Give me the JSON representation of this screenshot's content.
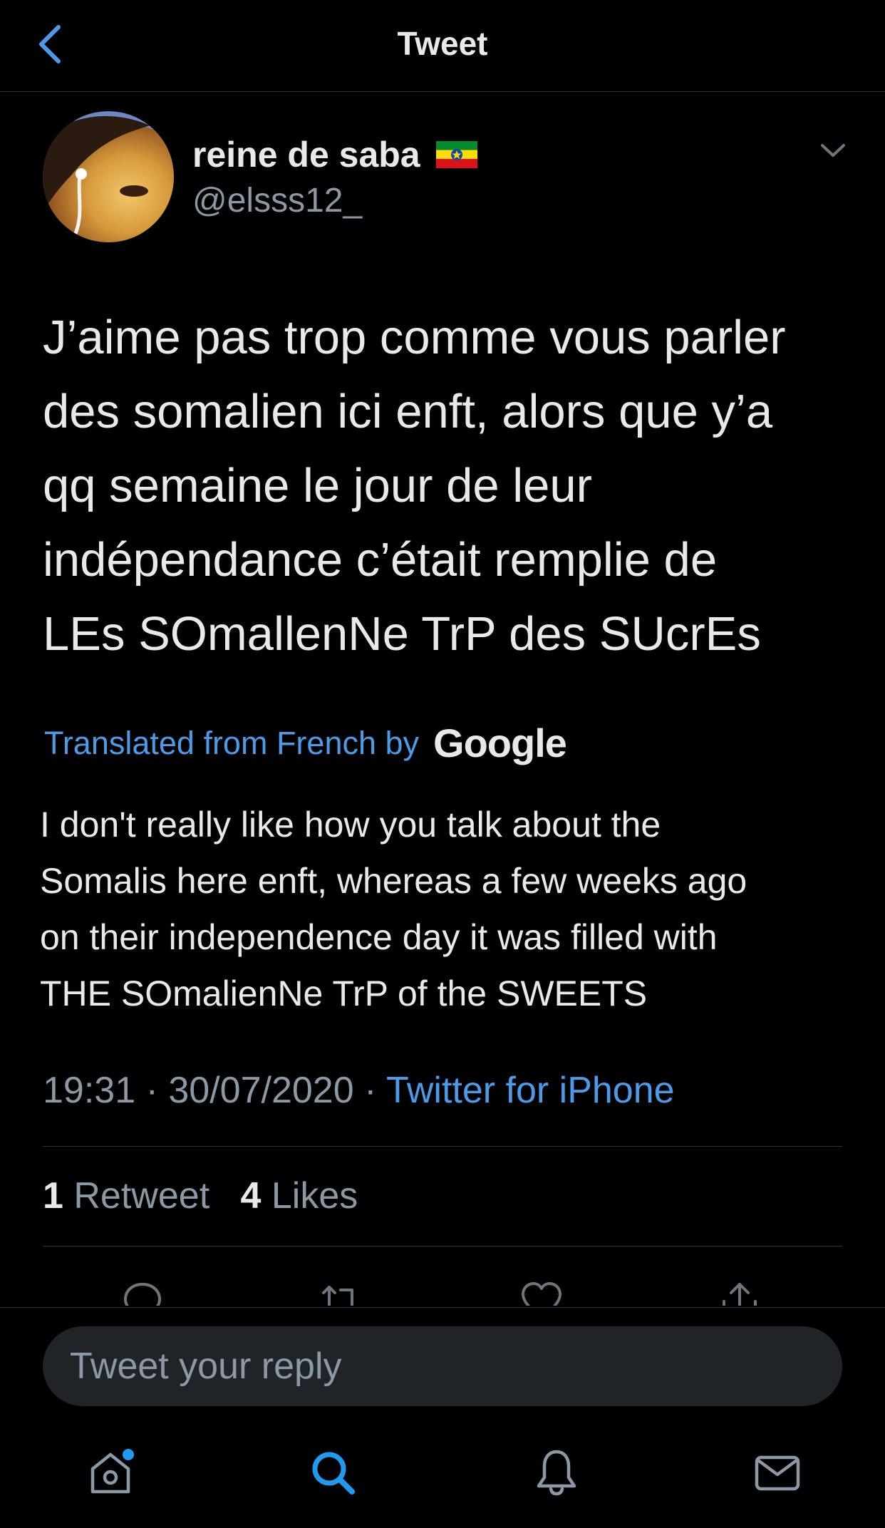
{
  "header": {
    "title": "Tweet"
  },
  "author": {
    "display_name": "reine de saba",
    "handle": "@elsss12_"
  },
  "tweet": {
    "lines": [
      "J’aime pas trop comme vous parler",
      "des somalien ici enft, alors que y’a",
      "qq semaine le jour de leur",
      "indépendance c’était remplie de",
      "LEs SOmallenNe TrP des SUcrEs"
    ]
  },
  "translation": {
    "label": "Translated from French by",
    "provider": "Google",
    "lines": [
      "I don't really like how you talk about the",
      "Somalis here enft, whereas a few weeks ago",
      "on their independence day it was filled with",
      "THE SOmalienNe TrP of the SWEETS"
    ]
  },
  "meta": {
    "time": "19:31",
    "date": "30/07/2020",
    "source": "Twitter for iPhone",
    "separator": "·"
  },
  "stats": {
    "retweets_count": "1",
    "retweets_label": "Retweet",
    "likes_count": "4",
    "likes_label": "Likes"
  },
  "composer": {
    "placeholder": "Tweet your reply"
  },
  "icons": {
    "back": "chevron-left-icon",
    "menu": "chevron-down-icon",
    "reply": "comment-icon",
    "retweet": "retweet-icon",
    "like": "heart-icon",
    "share": "share-icon",
    "home": "home-icon",
    "search": "search-icon",
    "notifications": "bell-icon",
    "messages": "mail-icon"
  },
  "colors": {
    "background": "#000000",
    "accent": "#4a9be8",
    "text_primary": "#e7e9ea",
    "text_secondary": "#8b98a5",
    "divider": "#2f3336",
    "flag_green": "#078930",
    "flag_yellow": "#fcdd09",
    "flag_red": "#da121a",
    "flag_emblem": "#0f47af"
  }
}
